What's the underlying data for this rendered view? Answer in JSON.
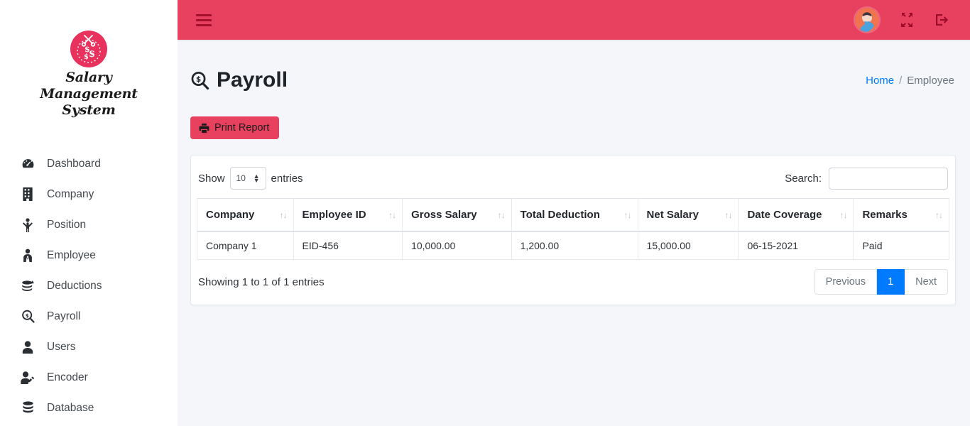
{
  "brand": {
    "name_line1": "Salary Management",
    "name_line2": "System",
    "logo_name": "salary-management-logo"
  },
  "sidebar": {
    "items": [
      {
        "label": "Dashboard",
        "icon": "dashboard-icon"
      },
      {
        "label": "Company",
        "icon": "building-icon"
      },
      {
        "label": "Position",
        "icon": "person-raised-arms-icon"
      },
      {
        "label": "Employee",
        "icon": "employee-tie-icon"
      },
      {
        "label": "Deductions",
        "icon": "coins-icon"
      },
      {
        "label": "Payroll",
        "icon": "magnifier-dollar-icon"
      },
      {
        "label": "Users",
        "icon": "user-icon"
      },
      {
        "label": "Encoder",
        "icon": "user-edit-icon"
      },
      {
        "label": "Database",
        "icon": "database-icon"
      }
    ]
  },
  "topbar": {
    "menu_toggle": "hamburger-icon",
    "avatar": "user-avatar",
    "fullscreen": "expand-arrows-icon",
    "logout": "logout-icon",
    "background_color": "#e8405f"
  },
  "page": {
    "title": "Payroll",
    "title_icon": "magnifier-dollar-icon",
    "print_button": "Print Report",
    "print_icon": "printer-icon",
    "breadcrumb": {
      "home": "Home",
      "separator": "/",
      "current": "Employee"
    }
  },
  "datatable": {
    "show_label": "Show",
    "entries_label": "entries",
    "page_length": "10",
    "search_label": "Search:",
    "search_value": "",
    "search_placeholder": "",
    "columns": [
      "Company",
      "Employee ID",
      "Gross Salary",
      "Total Deduction",
      "Net Salary",
      "Date Coverage",
      "Remarks"
    ],
    "rows": [
      [
        "Company 1",
        "EID-456",
        "10,000.00",
        "1,200.00",
        "15,000.00",
        "06-15-2021",
        "Paid"
      ]
    ],
    "info": "Showing 1 to 1 of 1 entries",
    "pagination": {
      "previous": "Previous",
      "pages": [
        "1"
      ],
      "next": "Next",
      "active_page": "1",
      "active_color": "#007bff"
    }
  }
}
